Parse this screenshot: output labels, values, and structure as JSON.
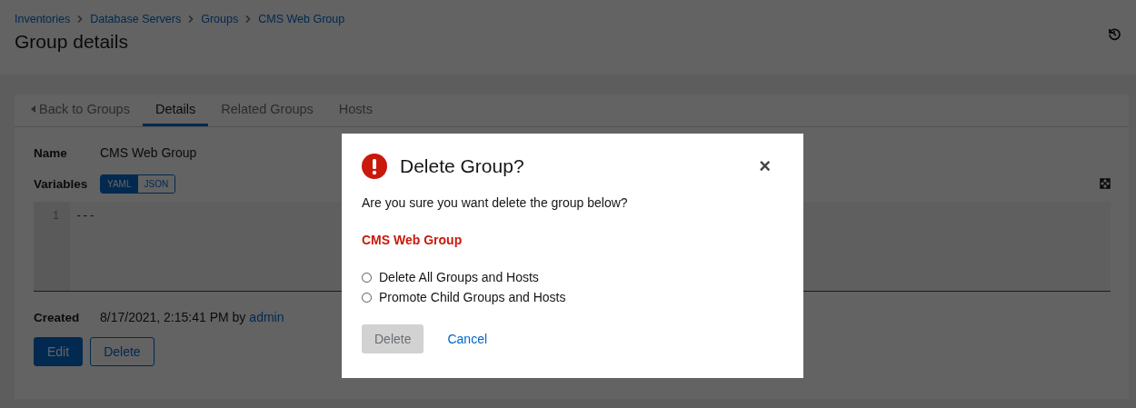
{
  "breadcrumbs": [
    "Inventories",
    "Database Servers",
    "Groups",
    "CMS Web Group"
  ],
  "page_title": "Group details",
  "tabs": [
    {
      "label": "Back to Groups",
      "kind": "back",
      "selected": false
    },
    {
      "label": "Details",
      "kind": "tab",
      "selected": true
    },
    {
      "label": "Related Groups",
      "kind": "tab",
      "selected": false
    },
    {
      "label": "Hosts",
      "kind": "tab",
      "selected": false
    }
  ],
  "details": {
    "name_label": "Name",
    "name_value": "CMS Web Group",
    "variables_label": "Variables",
    "format_toggle": [
      {
        "label": "YAML",
        "selected": true
      },
      {
        "label": "JSON",
        "selected": false
      }
    ],
    "editor": {
      "line_number": "1",
      "code": "---"
    },
    "created_label": "Created",
    "created_value": "8/17/2021, 2:15:41 PM by",
    "created_user": "admin",
    "buttons": [
      {
        "label": "Edit",
        "kind": "primary"
      },
      {
        "label": "Delete",
        "kind": "secondary"
      }
    ]
  },
  "modal": {
    "title": "Delete Group?",
    "message": "Are you sure you want delete the group below?",
    "group_name": "CMS Web Group",
    "options": [
      {
        "label": "Delete All Groups and Hosts",
        "selected": false
      },
      {
        "label": "Promote Child Groups and Hosts",
        "selected": false
      }
    ],
    "confirm": {
      "label": "Delete",
      "disabled": true
    },
    "cancel": "Cancel",
    "close": "×"
  }
}
